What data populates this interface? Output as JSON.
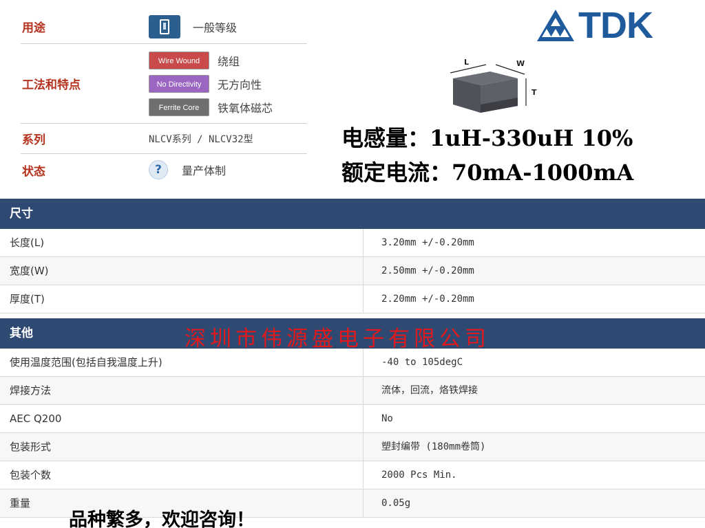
{
  "info": {
    "usage_label": "用途",
    "usage_value": "一般等级",
    "process_label": "工法和特点",
    "features": [
      {
        "badge": "Wire Wound",
        "text": "绕组"
      },
      {
        "badge": "No Directivity",
        "text": "无方向性"
      },
      {
        "badge": "Ferrite Core",
        "text": "铁氧体磁芯"
      }
    ],
    "series_label": "系列",
    "series_value": "NLCV系列 / NLCV32型",
    "status_label": "状态",
    "status_icon": "?",
    "status_value": "量产体制"
  },
  "logo": {
    "text": "TDK",
    "color": "#1f5b9c"
  },
  "component": {
    "label_l": "L",
    "label_w": "W",
    "label_t": "T"
  },
  "specs": {
    "inductance": "电感量：1uH-330uH 10%",
    "current": "额定电流：70mA-1000mA"
  },
  "dimensions": {
    "header": "尺寸",
    "rows": [
      {
        "name": "长度(L)",
        "value": "3.20mm +/-0.20mm"
      },
      {
        "name": "宽度(W)",
        "value": "2.50mm +/-0.20mm"
      },
      {
        "name": "厚度(T)",
        "value": "2.20mm +/-0.20mm"
      }
    ]
  },
  "other": {
    "header": "其他",
    "rows": [
      {
        "name": "使用温度范围(包括自我温度上升)",
        "value": "-40 to 105degC"
      },
      {
        "name": "焊接方法",
        "value": "流体，回流，烙铁焊接"
      },
      {
        "name": "AEC Q200",
        "value": "No"
      },
      {
        "name": "包装形式",
        "value": "塑封编带 (180mm卷筒)"
      },
      {
        "name": "包装个数",
        "value": "2000 Pcs Min."
      },
      {
        "name": "重量",
        "value": "0.05g"
      }
    ]
  },
  "company": "深圳市伟源盛电子有限公司",
  "slogan": "品种繁多，欢迎咨询！",
  "colors": {
    "header_bg": "#2e4a73",
    "label_red": "#b5321f",
    "company_red": "#e0191d"
  }
}
